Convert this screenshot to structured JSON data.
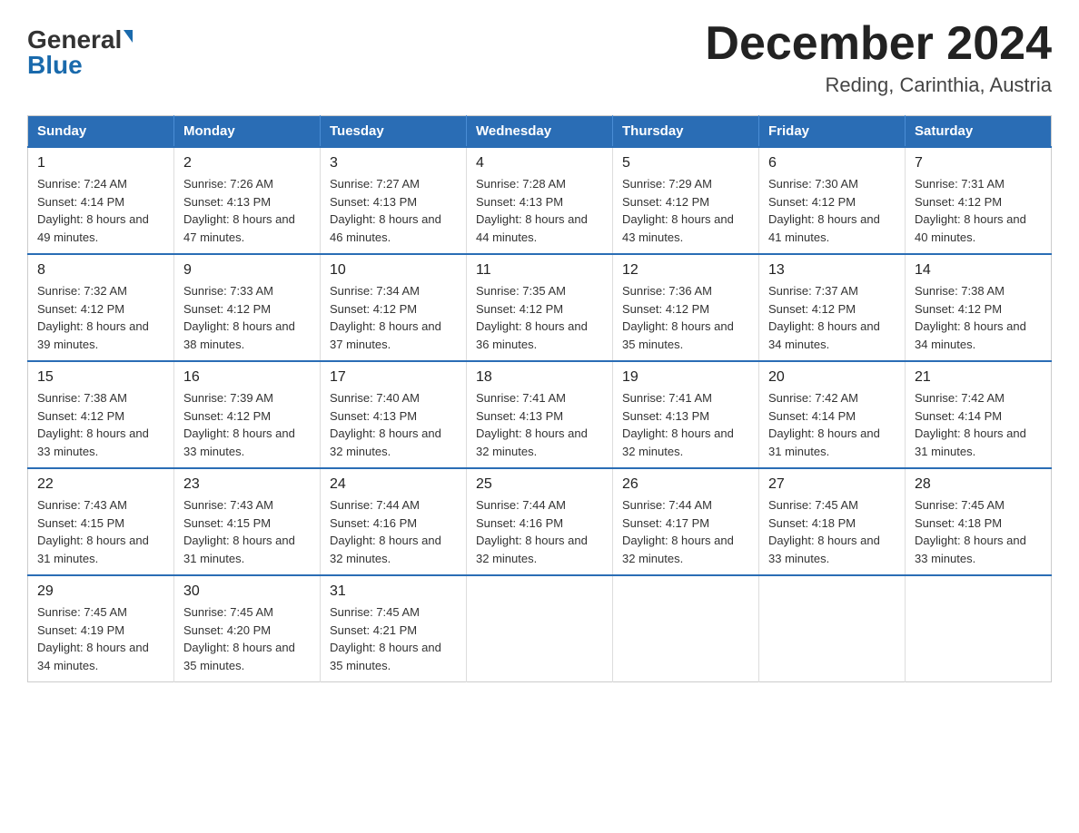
{
  "logo": {
    "general": "General",
    "blue": "Blue"
  },
  "title": "December 2024",
  "subtitle": "Reding, Carinthia, Austria",
  "days_of_week": [
    "Sunday",
    "Monday",
    "Tuesday",
    "Wednesday",
    "Thursday",
    "Friday",
    "Saturday"
  ],
  "weeks": [
    [
      {
        "day": "1",
        "sunrise": "Sunrise: 7:24 AM",
        "sunset": "Sunset: 4:14 PM",
        "daylight": "Daylight: 8 hours and 49 minutes."
      },
      {
        "day": "2",
        "sunrise": "Sunrise: 7:26 AM",
        "sunset": "Sunset: 4:13 PM",
        "daylight": "Daylight: 8 hours and 47 minutes."
      },
      {
        "day": "3",
        "sunrise": "Sunrise: 7:27 AM",
        "sunset": "Sunset: 4:13 PM",
        "daylight": "Daylight: 8 hours and 46 minutes."
      },
      {
        "day": "4",
        "sunrise": "Sunrise: 7:28 AM",
        "sunset": "Sunset: 4:13 PM",
        "daylight": "Daylight: 8 hours and 44 minutes."
      },
      {
        "day": "5",
        "sunrise": "Sunrise: 7:29 AM",
        "sunset": "Sunset: 4:12 PM",
        "daylight": "Daylight: 8 hours and 43 minutes."
      },
      {
        "day": "6",
        "sunrise": "Sunrise: 7:30 AM",
        "sunset": "Sunset: 4:12 PM",
        "daylight": "Daylight: 8 hours and 41 minutes."
      },
      {
        "day": "7",
        "sunrise": "Sunrise: 7:31 AM",
        "sunset": "Sunset: 4:12 PM",
        "daylight": "Daylight: 8 hours and 40 minutes."
      }
    ],
    [
      {
        "day": "8",
        "sunrise": "Sunrise: 7:32 AM",
        "sunset": "Sunset: 4:12 PM",
        "daylight": "Daylight: 8 hours and 39 minutes."
      },
      {
        "day": "9",
        "sunrise": "Sunrise: 7:33 AM",
        "sunset": "Sunset: 4:12 PM",
        "daylight": "Daylight: 8 hours and 38 minutes."
      },
      {
        "day": "10",
        "sunrise": "Sunrise: 7:34 AM",
        "sunset": "Sunset: 4:12 PM",
        "daylight": "Daylight: 8 hours and 37 minutes."
      },
      {
        "day": "11",
        "sunrise": "Sunrise: 7:35 AM",
        "sunset": "Sunset: 4:12 PM",
        "daylight": "Daylight: 8 hours and 36 minutes."
      },
      {
        "day": "12",
        "sunrise": "Sunrise: 7:36 AM",
        "sunset": "Sunset: 4:12 PM",
        "daylight": "Daylight: 8 hours and 35 minutes."
      },
      {
        "day": "13",
        "sunrise": "Sunrise: 7:37 AM",
        "sunset": "Sunset: 4:12 PM",
        "daylight": "Daylight: 8 hours and 34 minutes."
      },
      {
        "day": "14",
        "sunrise": "Sunrise: 7:38 AM",
        "sunset": "Sunset: 4:12 PM",
        "daylight": "Daylight: 8 hours and 34 minutes."
      }
    ],
    [
      {
        "day": "15",
        "sunrise": "Sunrise: 7:38 AM",
        "sunset": "Sunset: 4:12 PM",
        "daylight": "Daylight: 8 hours and 33 minutes."
      },
      {
        "day": "16",
        "sunrise": "Sunrise: 7:39 AM",
        "sunset": "Sunset: 4:12 PM",
        "daylight": "Daylight: 8 hours and 33 minutes."
      },
      {
        "day": "17",
        "sunrise": "Sunrise: 7:40 AM",
        "sunset": "Sunset: 4:13 PM",
        "daylight": "Daylight: 8 hours and 32 minutes."
      },
      {
        "day": "18",
        "sunrise": "Sunrise: 7:41 AM",
        "sunset": "Sunset: 4:13 PM",
        "daylight": "Daylight: 8 hours and 32 minutes."
      },
      {
        "day": "19",
        "sunrise": "Sunrise: 7:41 AM",
        "sunset": "Sunset: 4:13 PM",
        "daylight": "Daylight: 8 hours and 32 minutes."
      },
      {
        "day": "20",
        "sunrise": "Sunrise: 7:42 AM",
        "sunset": "Sunset: 4:14 PM",
        "daylight": "Daylight: 8 hours and 31 minutes."
      },
      {
        "day": "21",
        "sunrise": "Sunrise: 7:42 AM",
        "sunset": "Sunset: 4:14 PM",
        "daylight": "Daylight: 8 hours and 31 minutes."
      }
    ],
    [
      {
        "day": "22",
        "sunrise": "Sunrise: 7:43 AM",
        "sunset": "Sunset: 4:15 PM",
        "daylight": "Daylight: 8 hours and 31 minutes."
      },
      {
        "day": "23",
        "sunrise": "Sunrise: 7:43 AM",
        "sunset": "Sunset: 4:15 PM",
        "daylight": "Daylight: 8 hours and 31 minutes."
      },
      {
        "day": "24",
        "sunrise": "Sunrise: 7:44 AM",
        "sunset": "Sunset: 4:16 PM",
        "daylight": "Daylight: 8 hours and 32 minutes."
      },
      {
        "day": "25",
        "sunrise": "Sunrise: 7:44 AM",
        "sunset": "Sunset: 4:16 PM",
        "daylight": "Daylight: 8 hours and 32 minutes."
      },
      {
        "day": "26",
        "sunrise": "Sunrise: 7:44 AM",
        "sunset": "Sunset: 4:17 PM",
        "daylight": "Daylight: 8 hours and 32 minutes."
      },
      {
        "day": "27",
        "sunrise": "Sunrise: 7:45 AM",
        "sunset": "Sunset: 4:18 PM",
        "daylight": "Daylight: 8 hours and 33 minutes."
      },
      {
        "day": "28",
        "sunrise": "Sunrise: 7:45 AM",
        "sunset": "Sunset: 4:18 PM",
        "daylight": "Daylight: 8 hours and 33 minutes."
      }
    ],
    [
      {
        "day": "29",
        "sunrise": "Sunrise: 7:45 AM",
        "sunset": "Sunset: 4:19 PM",
        "daylight": "Daylight: 8 hours and 34 minutes."
      },
      {
        "day": "30",
        "sunrise": "Sunrise: 7:45 AM",
        "sunset": "Sunset: 4:20 PM",
        "daylight": "Daylight: 8 hours and 35 minutes."
      },
      {
        "day": "31",
        "sunrise": "Sunrise: 7:45 AM",
        "sunset": "Sunset: 4:21 PM",
        "daylight": "Daylight: 8 hours and 35 minutes."
      },
      null,
      null,
      null,
      null
    ]
  ]
}
